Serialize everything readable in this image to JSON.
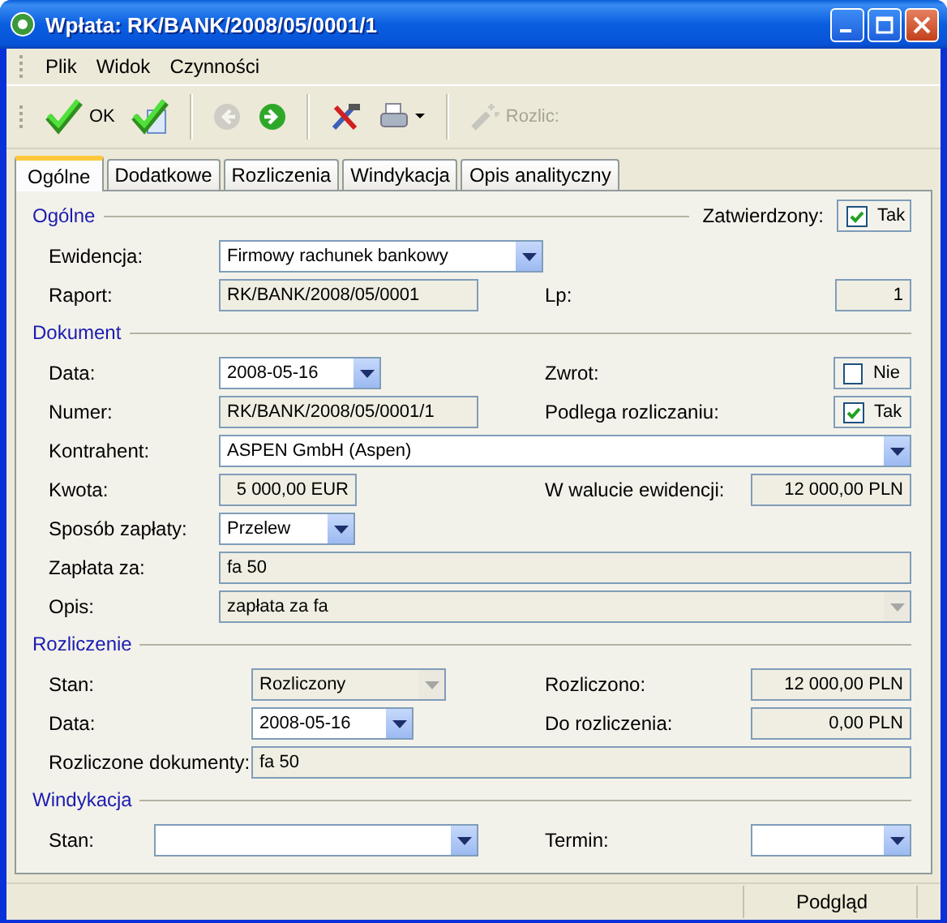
{
  "window": {
    "title": "Wpłata: RK/BANK/2008/05/0001/1"
  },
  "menu": [
    "Plik",
    "Widok",
    "Czynności"
  ],
  "toolbar": [
    {
      "kind": "confirm",
      "label": "OK",
      "disabled": false
    },
    {
      "kind": "approve",
      "disabled": false
    },
    {
      "kind": "separator"
    },
    {
      "kind": "back",
      "disabled": true
    },
    {
      "kind": "forward",
      "disabled": false
    },
    {
      "kind": "separator"
    },
    {
      "kind": "tools",
      "disabled": false
    },
    {
      "kind": "print",
      "disabled": false
    },
    {
      "kind": "separator"
    },
    {
      "kind": "settle",
      "label": "Rozlic:",
      "disabled": true
    }
  ],
  "tabs": [
    {
      "label": "Ogólne",
      "selected": true
    },
    {
      "label": "Dodatkowe",
      "selected": false
    },
    {
      "label": "Rozliczenia",
      "selected": false
    },
    {
      "label": "Windykacja",
      "selected": false
    },
    {
      "label": "Opis analityczny",
      "selected": false
    }
  ],
  "sections": [
    {
      "title": "Ogólne",
      "header_check": {
        "label": "Zatwierdzony:",
        "text": "Tak",
        "checked": true
      },
      "rows": [
        {
          "label": "Ewidencja:",
          "field": {
            "kind": "combo",
            "value": "Firmowy rachunek bankowy",
            "disabled": false
          }
        },
        {
          "label": "Raport:",
          "field": {
            "kind": "text",
            "value": "RK/BANK/2008/05/0001"
          },
          "right": {
            "label": "Lp:",
            "field": {
              "kind": "number",
              "value": "1"
            }
          }
        }
      ]
    },
    {
      "title": "Dokument",
      "rows": [
        {
          "label": "Data:",
          "field": {
            "kind": "combo",
            "value": "2008-05-16",
            "disabled": false
          },
          "right": {
            "label": "Zwrot:",
            "field": {
              "kind": "check",
              "text": "Nie",
              "checked": false
            }
          }
        },
        {
          "label": "Numer:",
          "field": {
            "kind": "text",
            "value": "RK/BANK/2008/05/0001/1"
          },
          "right": {
            "label": "Podlega rozliczaniu:",
            "field": {
              "kind": "check",
              "text": "Tak",
              "checked": true
            }
          }
        },
        {
          "label": "Kontrahent:",
          "field": {
            "kind": "combo",
            "value": "ASPEN GmbH (Aspen)",
            "disabled": false
          }
        },
        {
          "label": "Kwota:",
          "field": {
            "kind": "number",
            "value": "5 000,00 EUR"
          },
          "right": {
            "label": "W walucie ewidencji:",
            "field": {
              "kind": "number",
              "value": "12 000,00 PLN"
            }
          }
        },
        {
          "label": "Sposób zapłaty:",
          "field": {
            "kind": "combo",
            "value": "Przelew",
            "disabled": false
          }
        },
        {
          "label": "Zapłata za:",
          "field": {
            "kind": "text",
            "value": "fa 50"
          }
        },
        {
          "label": "Opis:",
          "field": {
            "kind": "combo",
            "value": "zapłata za fa",
            "disabled": true
          }
        }
      ]
    },
    {
      "title": "Rozliczenie",
      "rows": [
        {
          "label": "Stan:",
          "field": {
            "kind": "combo",
            "value": "Rozliczony",
            "disabled": true
          },
          "right": {
            "label": "Rozliczono:",
            "field": {
              "kind": "number",
              "value": "12 000,00 PLN"
            }
          }
        },
        {
          "label": "Data:",
          "field": {
            "kind": "combo",
            "value": "2008-05-16",
            "disabled": false
          },
          "right": {
            "label": "Do rozliczenia:",
            "field": {
              "kind": "number",
              "value": "0,00 PLN"
            }
          }
        },
        {
          "label": "Rozliczone dokumenty:",
          "field": {
            "kind": "text",
            "value": "fa 50"
          }
        }
      ]
    },
    {
      "title": "Windykacja",
      "rows": [
        {
          "label": "Stan:",
          "field": {
            "kind": "combo",
            "disabled": false
          },
          "right": {
            "label": "Termin:",
            "field": {
              "kind": "combo",
              "disabled": false
            }
          }
        }
      ]
    }
  ],
  "status_bar": {
    "mode": "Podgląd"
  }
}
